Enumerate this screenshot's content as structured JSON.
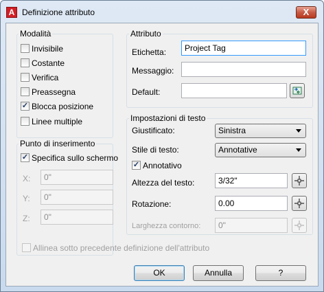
{
  "window": {
    "title": "Definizione attributo",
    "close_label": "X"
  },
  "modalita": {
    "title": "Modalità",
    "items": [
      {
        "label": "Invisibile",
        "checked": false
      },
      {
        "label": "Costante",
        "checked": false
      },
      {
        "label": "Verifica",
        "checked": false
      },
      {
        "label": "Preassegna",
        "checked": false
      },
      {
        "label": "Blocca posizione",
        "checked": true
      },
      {
        "label": "Linee multiple",
        "checked": false
      }
    ]
  },
  "insertion": {
    "title": "Punto di inserimento",
    "specify_label": "Specifica sullo schermo",
    "specify_checked": true,
    "fields": [
      {
        "label": "X:",
        "value": "0\""
      },
      {
        "label": "Y:",
        "value": "0\""
      },
      {
        "label": "Z:",
        "value": "0\""
      }
    ]
  },
  "attribute": {
    "title": "Attributo",
    "tag_label": "Etichetta:",
    "tag_value": "Project Tag",
    "prompt_label": "Messaggio:",
    "prompt_value": "",
    "default_label": "Default:",
    "default_value": ""
  },
  "text_settings": {
    "title": "Impostazioni di testo",
    "justify_label": "Giustificato:",
    "justify_value": "Sinistra",
    "style_label": "Stile di testo:",
    "style_value": "Annotative",
    "annotative_label": "Annotativo",
    "annotative_checked": true,
    "height_label": "Altezza del testo:",
    "height_value": "3/32\"",
    "rotation_label": "Rotazione:",
    "rotation_value": "0.00",
    "width_label": "Larghezza contorno:",
    "width_value": "0\""
  },
  "align_label": "Allinea sotto precedente definizione dell'attributo",
  "buttons": {
    "ok": "OK",
    "cancel": "Annulla",
    "help": "?"
  },
  "colors": {
    "accent": "#3399ff",
    "disabled_text": "#a0a0a0",
    "close_button": "#c75b46"
  },
  "icons": {
    "app": "autocad-a-icon",
    "field": "insert-field-icon",
    "pick": "pick-point-crosshair-icon"
  }
}
